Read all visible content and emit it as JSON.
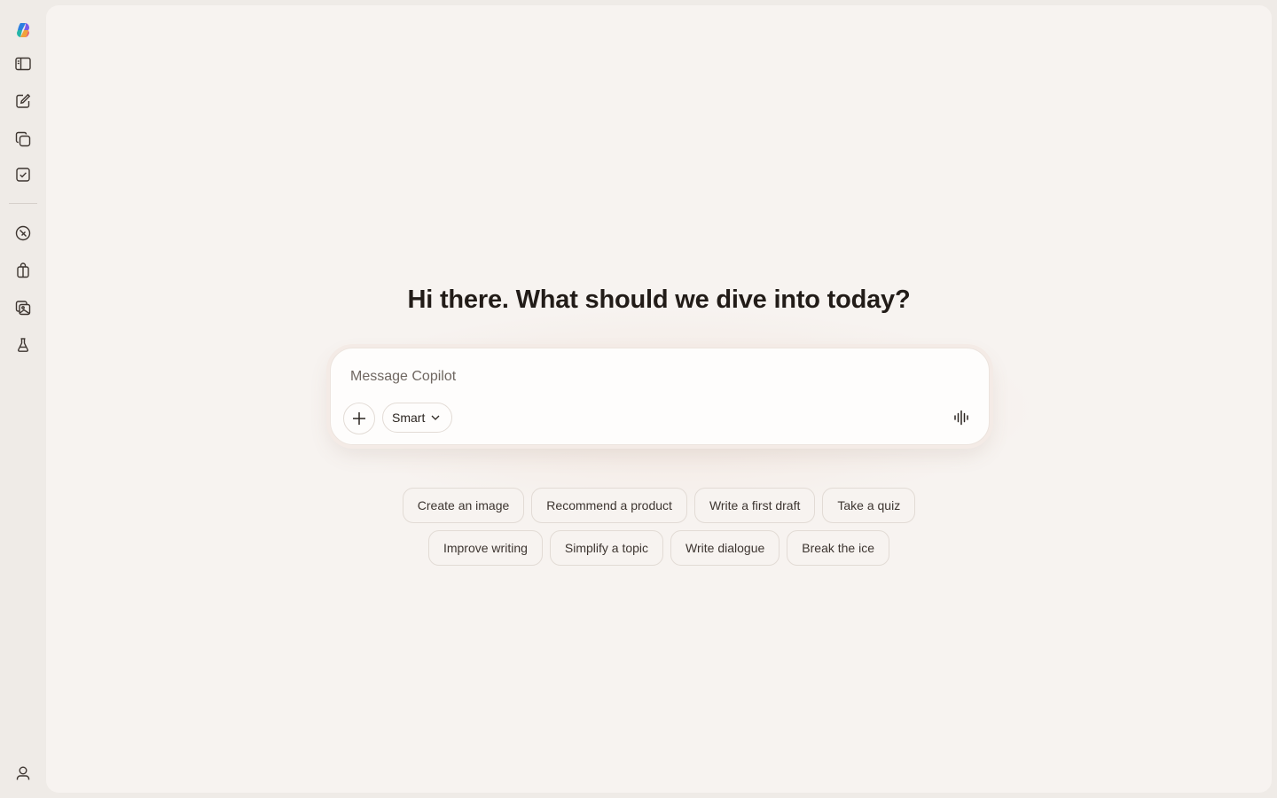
{
  "sidebar": {
    "icons": [
      {
        "name": "copilot-logo-icon"
      },
      {
        "name": "sidebar-toggle-icon"
      },
      {
        "name": "new-chat-icon"
      },
      {
        "name": "pages-icon"
      },
      {
        "name": "tasks-icon"
      },
      {
        "name": "discover-icon"
      },
      {
        "name": "shopping-icon"
      },
      {
        "name": "images-icon"
      },
      {
        "name": "labs-icon"
      },
      {
        "name": "profile-icon"
      }
    ]
  },
  "main": {
    "headline": "Hi there. What should we dive into today?",
    "composer": {
      "placeholder": "Message Copilot",
      "value": "",
      "mode_label": "Smart"
    },
    "suggestions_row1": [
      "Create an image",
      "Recommend a product",
      "Write a first draft",
      "Take a quiz"
    ],
    "suggestions_row2": [
      "Improve writing",
      "Simplify a topic",
      "Write dialogue",
      "Break the ice"
    ]
  },
  "colors": {
    "page_background": "#efebe7",
    "panel_background": "#f7f3f0",
    "text": "#2b2520"
  }
}
